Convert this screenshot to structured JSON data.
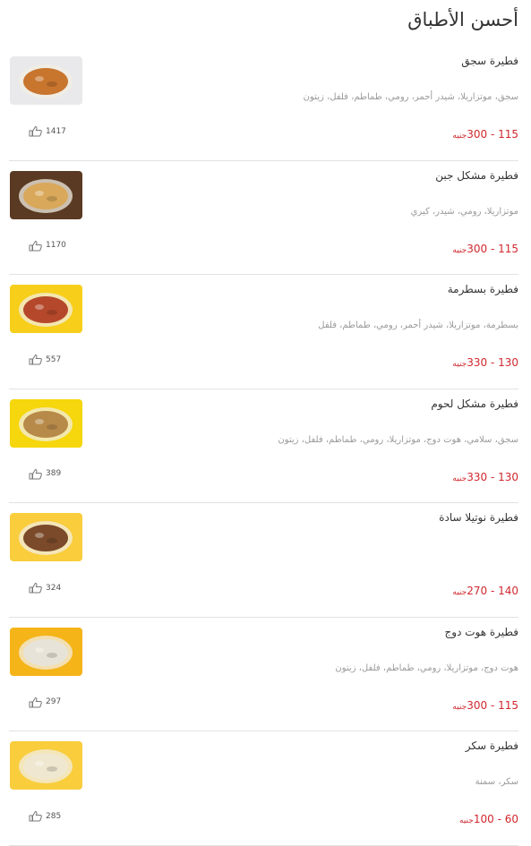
{
  "section_title": "أحسن الأطباق",
  "currency": "جنيه",
  "items": [
    {
      "name": "فطيرة سجق",
      "desc": "سجق، موتزاريلا، شيدر أحمر، رومي، طماطم، فلفل، زيتون",
      "price": "115 - 300",
      "likes": "1417",
      "photo_bg": "#e9e9ec",
      "photo_food": "#c8752e",
      "photo_icon": "sausage-pizza-photo"
    },
    {
      "name": "فطيرة مشكل جبن",
      "desc": "موتزاريلا، رومي، شيدر، كيري",
      "price": "115 - 300",
      "likes": "1170",
      "photo_bg": "#5a3a22",
      "photo_food": "#d9a85a",
      "photo_icon": "cheese-pie-photo"
    },
    {
      "name": "فطيرة بسطرمة",
      "desc": "بسطرمة، موتزاريلا، شيدر أحمر، رومي، طماطم، فلفل",
      "price": "130 - 330",
      "likes": "557",
      "photo_bg": "#f7cf1a",
      "photo_food": "#b5482b",
      "photo_icon": "pastrami-pie-photo"
    },
    {
      "name": "فطيرة مشكل لحوم",
      "desc": "سجق، سلامي، هوت دوج، موتزاريلا، رومي، طماطم، فلفل، زيتون",
      "price": "130 - 330",
      "likes": "389",
      "photo_bg": "#f6d60c",
      "photo_food": "#b88a4a",
      "photo_icon": "meat-pie-photo"
    },
    {
      "name": "فطيرة نوتيلا سادة",
      "desc": "",
      "price": "140 - 270",
      "likes": "324",
      "photo_bg": "#f9cd3c",
      "photo_food": "#7a4a2a",
      "photo_icon": "nutella-pie-photo"
    },
    {
      "name": "فطيرة هوت دوج",
      "desc": "هوت دوج، موتزاريلا، رومي، طماطم، فلفل، زيتون",
      "price": "115 - 300",
      "likes": "297",
      "photo_bg": "#f5b418",
      "photo_food": "#e8e3d8",
      "photo_icon": "hotdog-pie-photo"
    },
    {
      "name": "فطيرة سكر",
      "desc": "سكر، سمنة",
      "price": "60 - 100",
      "likes": "285",
      "photo_bg": "#f9cd3c",
      "photo_food": "#efe7cf",
      "photo_icon": "sugar-pie-photo"
    }
  ]
}
